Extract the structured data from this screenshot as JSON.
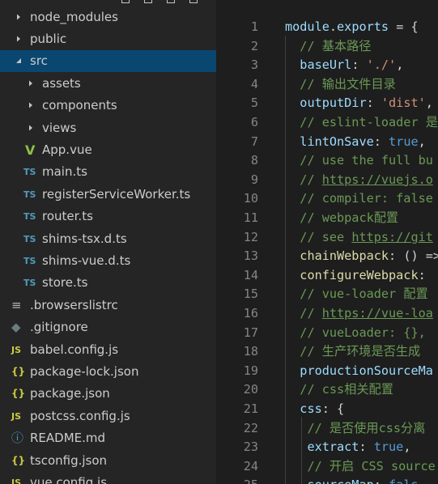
{
  "explorer": {
    "items": [
      {
        "label": "node_modules",
        "type": "folder",
        "expanded": false,
        "depth": 1
      },
      {
        "label": "public",
        "type": "folder",
        "expanded": false,
        "depth": 1
      },
      {
        "label": "src",
        "type": "folder",
        "expanded": true,
        "depth": 1,
        "selected": true
      },
      {
        "label": "assets",
        "type": "folder",
        "expanded": false,
        "depth": 2
      },
      {
        "label": "components",
        "type": "folder",
        "expanded": false,
        "depth": 2
      },
      {
        "label": "views",
        "type": "folder",
        "expanded": false,
        "depth": 2
      },
      {
        "label": "App.vue",
        "type": "file",
        "icon": "vue-icon",
        "glyph": "V",
        "depth": 2
      },
      {
        "label": "main.ts",
        "type": "file",
        "icon": "typescript-icon",
        "glyph": "TS",
        "depth": 2
      },
      {
        "label": "registerServiceWorker.ts",
        "type": "file",
        "icon": "typescript-icon",
        "glyph": "TS",
        "depth": 2
      },
      {
        "label": "router.ts",
        "type": "file",
        "icon": "typescript-icon",
        "glyph": "TS",
        "depth": 2
      },
      {
        "label": "shims-tsx.d.ts",
        "type": "file",
        "icon": "typescript-icon",
        "glyph": "TS",
        "depth": 2
      },
      {
        "label": "shims-vue.d.ts",
        "type": "file",
        "icon": "typescript-icon",
        "glyph": "TS",
        "depth": 2
      },
      {
        "label": "store.ts",
        "type": "file",
        "icon": "typescript-icon",
        "glyph": "TS",
        "depth": 2
      },
      {
        "label": ".browserslistrc",
        "type": "file",
        "icon": "lines-icon",
        "glyph": "≡",
        "depth": 1
      },
      {
        "label": ".gitignore",
        "type": "file",
        "icon": "git-icon",
        "glyph": "◆",
        "depth": 1
      },
      {
        "label": "babel.config.js",
        "type": "file",
        "icon": "javascript-icon",
        "glyph": "JS",
        "depth": 1
      },
      {
        "label": "package-lock.json",
        "type": "file",
        "icon": "json-icon",
        "glyph": "{}",
        "depth": 1
      },
      {
        "label": "package.json",
        "type": "file",
        "icon": "json-icon",
        "glyph": "{}",
        "depth": 1
      },
      {
        "label": "postcss.config.js",
        "type": "file",
        "icon": "javascript-icon",
        "glyph": "JS",
        "depth": 1
      },
      {
        "label": "README.md",
        "type": "file",
        "icon": "info-icon",
        "glyph": "ⓘ",
        "depth": 1
      },
      {
        "label": "tsconfig.json",
        "type": "file",
        "icon": "json-icon",
        "glyph": "{}",
        "depth": 1
      },
      {
        "label": "vue.config.js",
        "type": "file",
        "icon": "javascript-icon",
        "glyph": "JS",
        "depth": 1
      }
    ]
  },
  "editor": {
    "lines": [
      {
        "num": "1",
        "tokens": [
          [
            "k",
            "module"
          ],
          [
            "n",
            "."
          ],
          [
            "k",
            "exports"
          ],
          [
            "n",
            " = {"
          ]
        ]
      },
      {
        "num": "2",
        "tokens": [
          [
            "n",
            "  "
          ],
          [
            "c",
            "// 基本路径"
          ]
        ]
      },
      {
        "num": "3",
        "tokens": [
          [
            "n",
            "  "
          ],
          [
            "k",
            "baseUrl"
          ],
          [
            "n",
            ": "
          ],
          [
            "s",
            "'./'"
          ],
          [
            "n",
            ","
          ]
        ]
      },
      {
        "num": "4",
        "tokens": [
          [
            "n",
            "  "
          ],
          [
            "c",
            "// 输出文件目录"
          ]
        ]
      },
      {
        "num": "5",
        "tokens": [
          [
            "n",
            "  "
          ],
          [
            "k",
            "outputDir"
          ],
          [
            "n",
            ": "
          ],
          [
            "s",
            "'dist'"
          ],
          [
            "n",
            ","
          ]
        ]
      },
      {
        "num": "6",
        "tokens": [
          [
            "n",
            "  "
          ],
          [
            "c",
            "// eslint-loader 是"
          ]
        ]
      },
      {
        "num": "7",
        "tokens": [
          [
            "n",
            "  "
          ],
          [
            "k",
            "lintOnSave"
          ],
          [
            "n",
            ": "
          ],
          [
            "b",
            "true"
          ],
          [
            "n",
            ","
          ]
        ]
      },
      {
        "num": "8",
        "tokens": [
          [
            "n",
            "  "
          ],
          [
            "c",
            "// use the full bu"
          ]
        ]
      },
      {
        "num": "9",
        "tokens": [
          [
            "n",
            "  "
          ],
          [
            "c",
            "// "
          ],
          [
            "cu",
            "https://vuejs.o"
          ]
        ]
      },
      {
        "num": "10",
        "tokens": [
          [
            "n",
            "  "
          ],
          [
            "c",
            "// compiler: false"
          ]
        ]
      },
      {
        "num": "11",
        "tokens": [
          [
            "n",
            "  "
          ],
          [
            "c",
            "// webpack配置"
          ]
        ]
      },
      {
        "num": "12",
        "tokens": [
          [
            "n",
            "  "
          ],
          [
            "c",
            "// see "
          ],
          [
            "cu",
            "https://git"
          ]
        ]
      },
      {
        "num": "13",
        "tokens": [
          [
            "n",
            "  "
          ],
          [
            "y",
            "chainWebpack"
          ],
          [
            "n",
            ": () =>"
          ]
        ]
      },
      {
        "num": "14",
        "tokens": [
          [
            "n",
            "  "
          ],
          [
            "y",
            "configureWebpack"
          ],
          [
            "n",
            ":"
          ]
        ]
      },
      {
        "num": "15",
        "tokens": [
          [
            "n",
            "  "
          ],
          [
            "c",
            "// vue-loader 配置"
          ]
        ]
      },
      {
        "num": "16",
        "tokens": [
          [
            "n",
            "  "
          ],
          [
            "c",
            "// "
          ],
          [
            "cu",
            "https://vue-loa"
          ]
        ]
      },
      {
        "num": "17",
        "tokens": [
          [
            "n",
            "  "
          ],
          [
            "c",
            "// vueLoader: {},"
          ]
        ]
      },
      {
        "num": "18",
        "tokens": [
          [
            "n",
            "  "
          ],
          [
            "c",
            "// 生产环境是否生成"
          ]
        ]
      },
      {
        "num": "19",
        "tokens": [
          [
            "n",
            "  "
          ],
          [
            "k",
            "productionSourceMa"
          ]
        ]
      },
      {
        "num": "20",
        "tokens": [
          [
            "n",
            "  "
          ],
          [
            "c",
            "// css相关配置"
          ]
        ]
      },
      {
        "num": "21",
        "tokens": [
          [
            "n",
            "  "
          ],
          [
            "k",
            "css"
          ],
          [
            "n",
            ": {"
          ]
        ]
      },
      {
        "num": "22",
        "tokens": [
          [
            "n",
            "   "
          ],
          [
            "c",
            "// 是否使用css分离"
          ]
        ]
      },
      {
        "num": "23",
        "tokens": [
          [
            "n",
            "   "
          ],
          [
            "k",
            "extract"
          ],
          [
            "n",
            ": "
          ],
          [
            "b",
            "true"
          ],
          [
            "n",
            ","
          ]
        ]
      },
      {
        "num": "24",
        "tokens": [
          [
            "n",
            "   "
          ],
          [
            "c",
            "// 开启 CSS source"
          ]
        ]
      },
      {
        "num": "25",
        "tokens": [
          [
            "n",
            "   "
          ],
          [
            "k",
            "sourceMap"
          ],
          [
            "n",
            ": "
          ],
          [
            "b",
            "fals"
          ]
        ]
      }
    ]
  },
  "colors": {
    "sidebar_bg": "#252526",
    "editor_bg": "#1e1e1e",
    "selection": "#094771",
    "ts_icon": "#519aba",
    "vue_icon": "#8dc149",
    "json_icon": "#cbcb41",
    "js_icon": "#cbcb41",
    "info_icon": "#519aba",
    "git_icon": "#41535b"
  }
}
